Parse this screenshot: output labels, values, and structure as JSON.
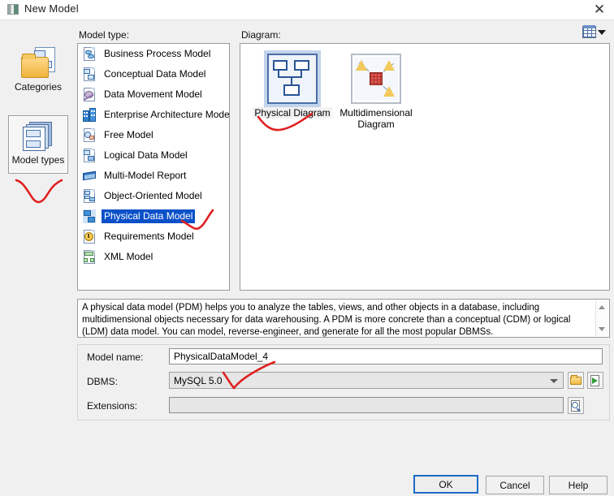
{
  "window": {
    "title": "New Model",
    "icon": "app-icon",
    "close_label": "✕"
  },
  "rail": {
    "items": [
      {
        "label": "Categories",
        "icon": "categories-icon",
        "selected": false
      },
      {
        "label": "Model types",
        "icon": "model-types-icon",
        "selected": true
      }
    ]
  },
  "model_type": {
    "label": "Model type:",
    "items": [
      {
        "label": "Business Process Model",
        "icon": "business-process-model-icon",
        "selected": false
      },
      {
        "label": "Conceptual Data Model",
        "icon": "conceptual-data-model-icon",
        "selected": false
      },
      {
        "label": "Data Movement Model",
        "icon": "data-movement-model-icon",
        "selected": false
      },
      {
        "label": "Enterprise Architecture Model",
        "icon": "enterprise-architecture-model-icon",
        "selected": false
      },
      {
        "label": "Free Model",
        "icon": "free-model-icon",
        "selected": false
      },
      {
        "label": "Logical Data Model",
        "icon": "logical-data-model-icon",
        "selected": false
      },
      {
        "label": "Multi-Model Report",
        "icon": "multi-model-report-icon",
        "selected": false
      },
      {
        "label": "Object-Oriented Model",
        "icon": "object-oriented-model-icon",
        "selected": false
      },
      {
        "label": "Physical Data Model",
        "icon": "physical-data-model-icon",
        "selected": true
      },
      {
        "label": "Requirements Model",
        "icon": "requirements-model-icon",
        "selected": false
      },
      {
        "label": "XML Model",
        "icon": "xml-model-icon",
        "selected": false
      }
    ]
  },
  "diagram": {
    "label": "Diagram:",
    "view_button_icon": "view-mode-grid-icon",
    "items": [
      {
        "label": "Physical Diagram",
        "icon": "physical-diagram-thumb",
        "selected": true
      },
      {
        "label": "Multidimensional Diagram",
        "icon": "multidimensional-diagram-thumb",
        "selected": false
      }
    ]
  },
  "description": {
    "text": "A physical data model (PDM) helps you to analyze the tables, views, and other objects in a database, including multidimensional objects necessary for data warehousing. A PDM is more concrete than a conceptual (CDM) or logical (LDM) data model. You can model, reverse-engineer, and generate for all the most popular DBMSs."
  },
  "form": {
    "model_name": {
      "label": "Model name:",
      "value": "PhysicalDataModel_4",
      "placeholder": ""
    },
    "dbms": {
      "label": "DBMS:",
      "value": "MySQL 5.0",
      "browse_icon": "folder-open-icon",
      "import_icon": "import-arrow-icon"
    },
    "extensions": {
      "label": "Extensions:",
      "value": "",
      "placeholder": "",
      "edit_icon": "magnifier-page-icon"
    }
  },
  "buttons": {
    "ok": "OK",
    "cancel": "Cancel",
    "help": "Help"
  },
  "colors": {
    "selection_blue": "#0a50c8",
    "default_button_border": "#1b6bc4",
    "annotation_red": "#e02020",
    "dialog_background": "#f0f0f0"
  }
}
